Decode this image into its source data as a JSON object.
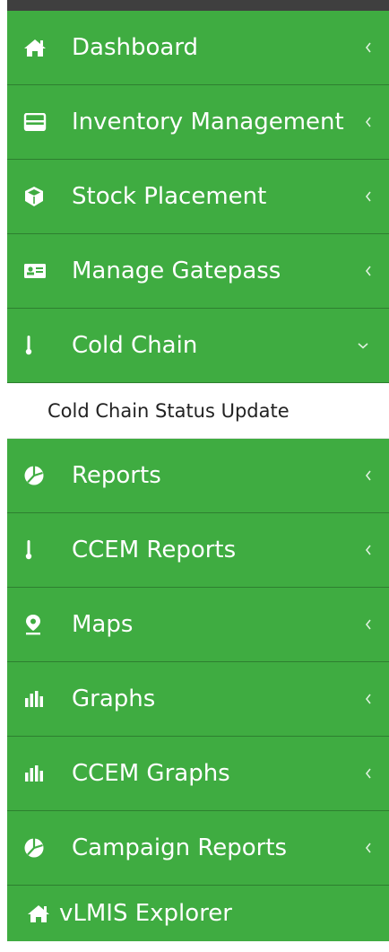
{
  "colors": {
    "menu_bg": "#3fac41",
    "menu_separator": "#2d7f2f",
    "menu_text": "#ffffff",
    "submenu_bg": "#ffffff",
    "submenu_text": "#222222"
  },
  "sidebar": {
    "items": [
      {
        "label": "Dashboard",
        "icon": "home-icon",
        "arrow": "chevron-left-icon"
      },
      {
        "label": "Inventory Management",
        "icon": "inbox-icon",
        "arrow": "chevron-left-icon"
      },
      {
        "label": "Stock Placement",
        "icon": "cube-icon",
        "arrow": "chevron-left-icon"
      },
      {
        "label": "Manage Gatepass",
        "icon": "id-card-icon",
        "arrow": "chevron-left-icon"
      },
      {
        "label": "Cold Chain",
        "icon": "thermometer-icon",
        "arrow": "chevron-down-icon",
        "expanded": true
      },
      {
        "label": "Reports",
        "icon": "pie-chart-icon",
        "arrow": "chevron-left-icon"
      },
      {
        "label": "CCEM Reports",
        "icon": "thermometer-icon",
        "arrow": "chevron-left-icon"
      },
      {
        "label": "Maps",
        "icon": "map-marker-icon",
        "arrow": "chevron-left-icon"
      },
      {
        "label": "Graphs",
        "icon": "bar-chart-icon",
        "arrow": "chevron-left-icon"
      },
      {
        "label": "CCEM Graphs",
        "icon": "bar-chart-icon",
        "arrow": "chevron-left-icon"
      },
      {
        "label": "Campaign Reports",
        "icon": "pie-chart-icon",
        "arrow": "chevron-left-icon"
      },
      {
        "label": "vLMIS Explorer",
        "icon": "home-icon"
      }
    ],
    "cold_chain_submenu": [
      {
        "label": "Cold Chain Status Update"
      }
    ]
  }
}
